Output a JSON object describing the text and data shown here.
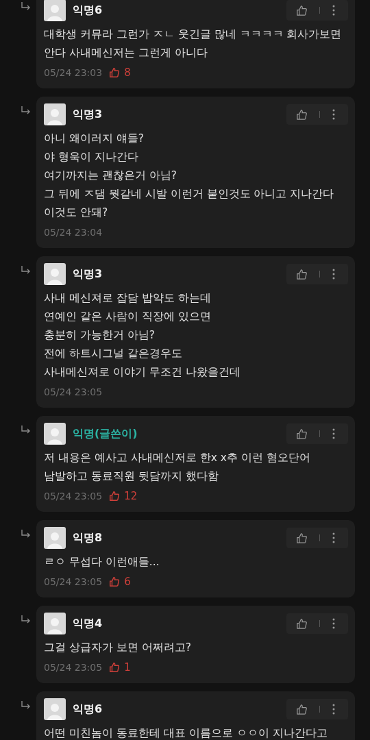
{
  "comments": [
    {
      "author": "익명6",
      "is_author": false,
      "lines": [
        "대학생 커뮤라 그런가 ㅈㄴ 웃긴글 많네 ㅋㅋㅋㅋ 회사가보면",
        "안다 사내메신저는 그런게 아니다"
      ],
      "time": "05/24 23:03",
      "likes": "8"
    },
    {
      "author": "익명3",
      "is_author": false,
      "lines": [
        "아니 왜이러지 얘들?",
        "야 형욱이 지나간다",
        "여기까지는 괜찮은거 아님?",
        "그 뒤에 ㅈ댐 뭣같네 시발 이런거 붙인것도 아니고 지나간다",
        "이것도 안돼?"
      ],
      "time": "05/24 23:04"
    },
    {
      "author": "익명3",
      "is_author": false,
      "lines": [
        "사내 메신져로 잡담 밥약도 하는데",
        "연예인 같은 사람이 직장에 있으면",
        "충분히 가능한거 아님?",
        "전에 하트시그널 같은경우도",
        "사내메신져로 이야기 무조건 나왔을건데"
      ],
      "time": "05/24 23:05"
    },
    {
      "author": "익명(글쓴이)",
      "is_author": true,
      "lines": [
        "저 내용은 예사고 사내메신저로 한x x추 이런 혐오단어",
        "남발하고 동료직원 뒷담까지 했다함"
      ],
      "time": "05/24 23:05",
      "likes": "12"
    },
    {
      "author": "익명8",
      "is_author": false,
      "lines": [
        "ㄹㅇ 무섭다 이런애들..."
      ],
      "time": "05/24 23:05",
      "likes": "6"
    },
    {
      "author": "익명4",
      "is_author": false,
      "lines": [
        "그걸 상급자가 보면 어쩌려고?"
      ],
      "time": "05/24 23:05",
      "likes": "1"
    },
    {
      "author": "익명6",
      "is_author": false,
      "lines": [
        "어떤 미친놈이 동료한테 대표 이름으로 ㅇㅇ이 지나간다고"
      ]
    }
  ]
}
